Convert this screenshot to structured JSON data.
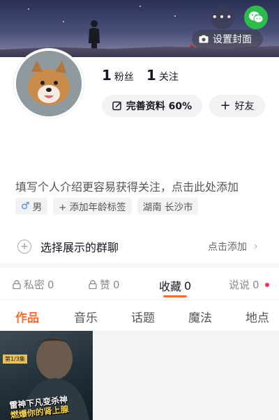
{
  "header": {
    "more_label": "•••",
    "set_cover_label": "设置封面"
  },
  "profile": {
    "fans_count": "1",
    "fans_label": "粉丝",
    "following_count": "1",
    "following_label": "关注",
    "complete_label": "完善资料 60%",
    "friend_label": "好友",
    "bio_placeholder": "填写个人介绍更容易获得关注，点击此处添加",
    "tags": [
      {
        "icon": "male-icon",
        "text": "男"
      },
      {
        "icon": "plus-icon",
        "text": "+ 添加年龄标签"
      },
      {
        "icon": "",
        "text": "湖南 长沙市"
      }
    ]
  },
  "group": {
    "label": "选择展示的群聊",
    "action": "点击添加"
  },
  "subtabs": [
    {
      "label": "私密",
      "count": "0"
    },
    {
      "label": "赞",
      "count": "0"
    },
    {
      "label": "收藏",
      "count": "0"
    },
    {
      "label": "说说",
      "count": "0"
    }
  ],
  "maintabs": [
    "作品",
    "音乐",
    "话题",
    "魔法",
    "地点"
  ],
  "video": {
    "badge": "第1/3集",
    "title_line1": "雷神下凡变杀神",
    "title_line2": "燃爆你的肾上腺"
  },
  "colors": {
    "accent": "#fe6b2b",
    "wechat_green": "#2bbc4b",
    "dot_red": "#fe2c55"
  }
}
